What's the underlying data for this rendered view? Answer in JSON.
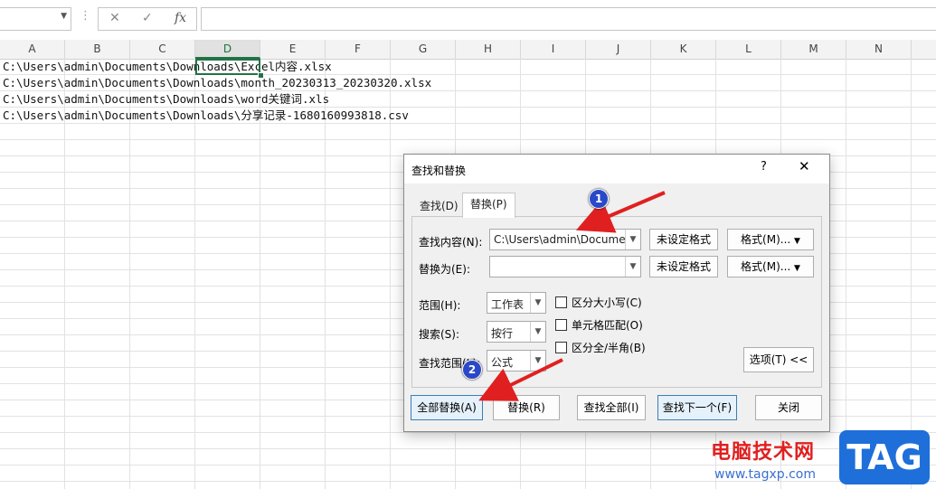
{
  "formula_bar": {
    "namebox_value": "",
    "fx_label": "fx",
    "cancel_glyph": "✕",
    "enter_glyph": "✓",
    "formula_value": ""
  },
  "columns": [
    "A",
    "B",
    "C",
    "D",
    "E",
    "F",
    "G",
    "H",
    "I",
    "J",
    "K",
    "L",
    "M",
    "N"
  ],
  "active_column": "D",
  "cells": [
    "C:\\Users\\admin\\Documents\\Downloads\\Excel内容.xlsx",
    "C:\\Users\\admin\\Documents\\Downloads\\month_20230313_20230320.xlsx",
    "C:\\Users\\admin\\Documents\\Downloads\\word关键词.xls",
    "C:\\Users\\admin\\Documents\\Downloads\\分享记录-1680160993818.csv"
  ],
  "dialog": {
    "title": "查找和替换",
    "help": "?",
    "close": "✕",
    "tabs": {
      "find": "查找(D)",
      "replace": "替换(P)"
    },
    "find_label": "查找内容(N):",
    "find_value": "C:\\Users\\admin\\Documen",
    "replace_label": "替换为(E):",
    "replace_value": "",
    "no_format": "未设定格式",
    "format_button": "格式(M)...",
    "scope_label": "范围(H):",
    "scope_value": "工作表",
    "search_label": "搜索(S):",
    "search_value": "按行",
    "lookin_label": "查找范围(L):",
    "lookin_value": "公式",
    "match_case": "区分大小写(C)",
    "match_cell": "单元格匹配(O)",
    "match_width": "区分全/半角(B)",
    "options_button": "选项(T) <<",
    "replace_all": "全部替换(A)",
    "replace": "替换(R)",
    "find_all": "查找全部(I)",
    "find_next": "查找下一个(F)",
    "close_button": "关闭"
  },
  "annotations": {
    "badge1": "1",
    "badge2": "2",
    "arrow_color": "#e02020"
  },
  "watermark": {
    "text": "电脑技术网",
    "url": "www.tagxp.com",
    "logo": "TAG"
  }
}
